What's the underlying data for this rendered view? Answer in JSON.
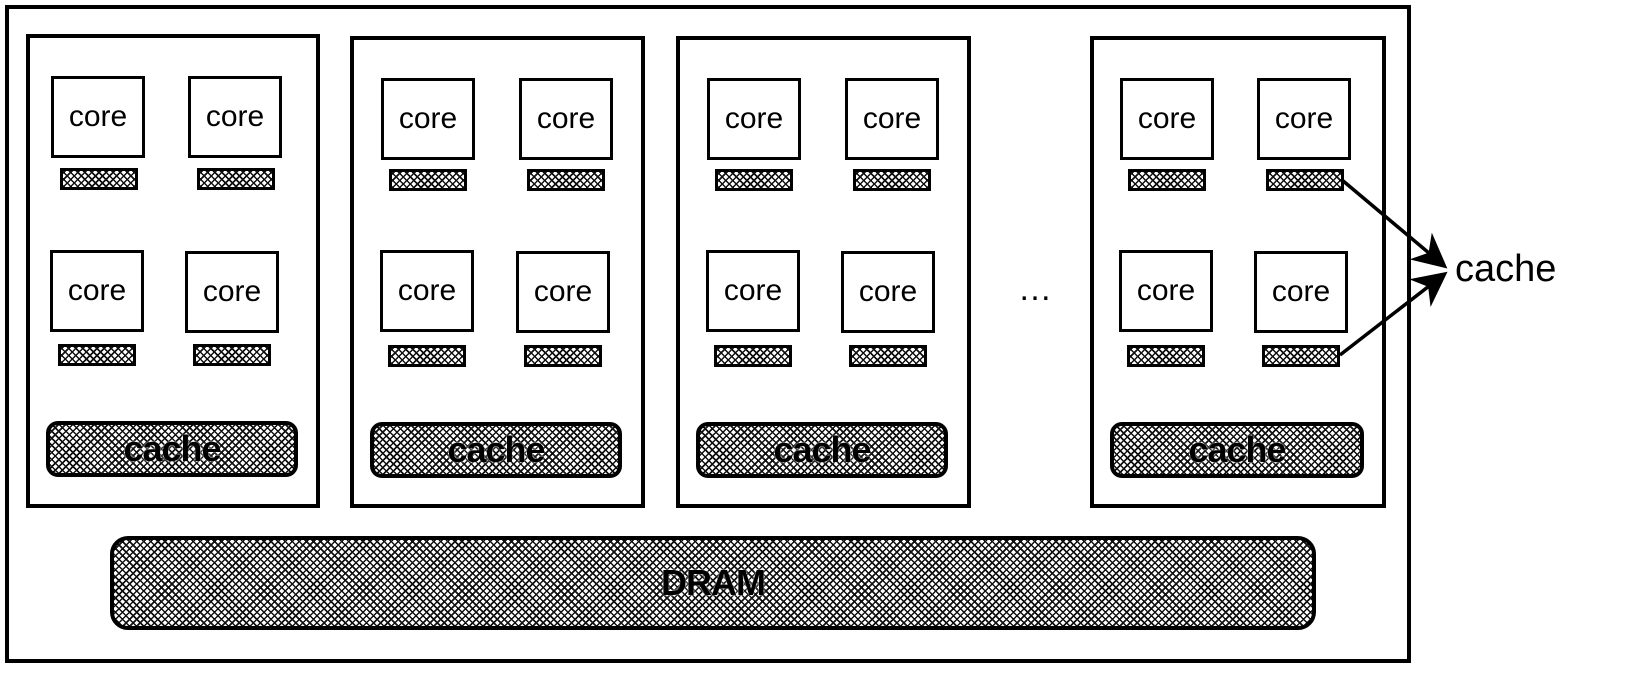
{
  "diagram": {
    "title": "",
    "clusters": [
      {
        "cores": [
          "core",
          "core",
          "core",
          "core"
        ],
        "shared_cache_label": "cache"
      },
      {
        "cores": [
          "core",
          "core",
          "core",
          "core"
        ],
        "shared_cache_label": "cache"
      },
      {
        "cores": [
          "core",
          "core",
          "core",
          "core"
        ],
        "shared_cache_label": "cache"
      },
      {
        "cores": [
          "core",
          "core",
          "core",
          "core"
        ],
        "shared_cache_label": "cache"
      }
    ],
    "ellipsis": "…",
    "memory_label": "DRAM",
    "callout_label": "cache",
    "colors": {
      "line": "#000000",
      "background": "#ffffff",
      "hatch": "#111111"
    }
  }
}
